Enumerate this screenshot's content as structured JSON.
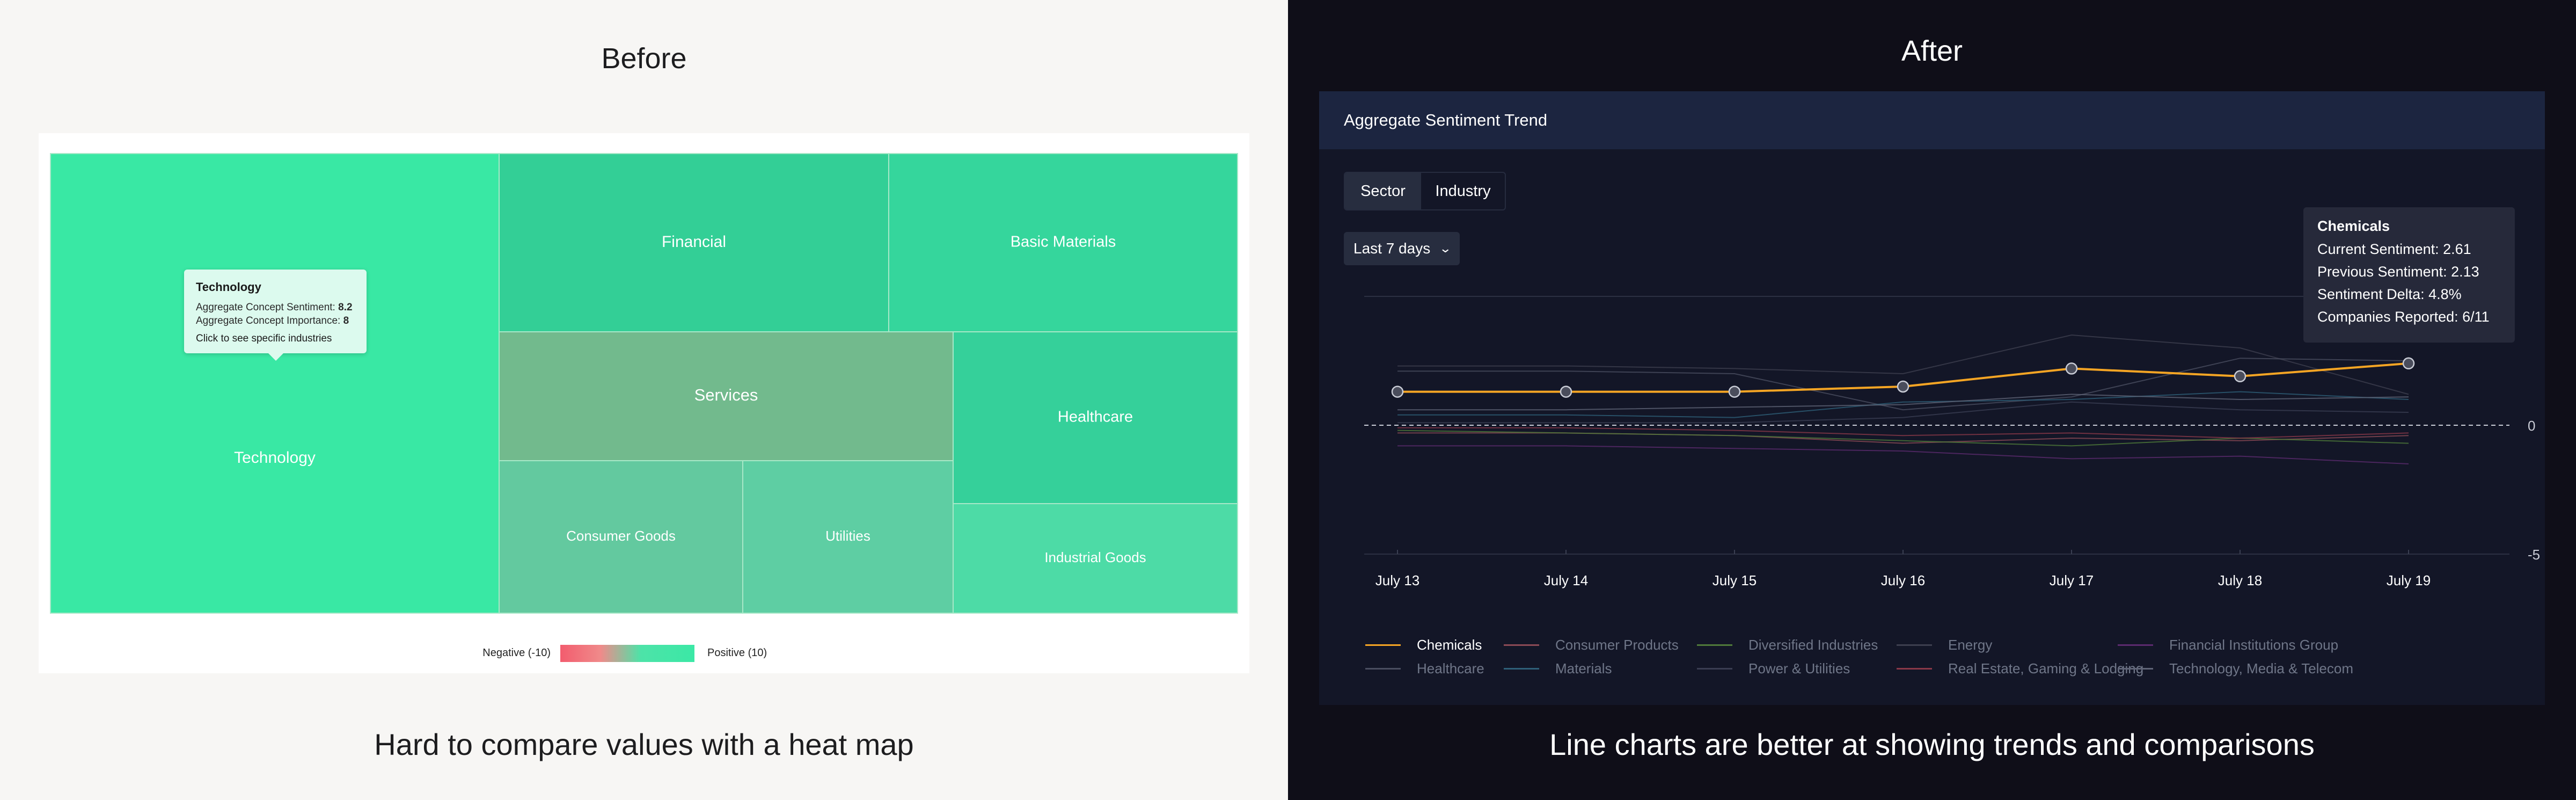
{
  "before": {
    "title": "Before",
    "caption": "Hard to compare values with a heat map",
    "tooltip": {
      "title": "Technology",
      "sentiment_label": "Aggregate Concept Sentiment:",
      "sentiment_value": "8.2",
      "importance_label": "Aggregate Concept Importance:",
      "importance_value": "8",
      "hint": "Click to see specific industries"
    },
    "legend": {
      "negative": "Negative (-10)",
      "positive": "Positive (10)"
    }
  },
  "after": {
    "title": "After",
    "caption": "Line charts are better at showing trends and comparisons",
    "card_title": "Aggregate Sentiment Trend",
    "segments": [
      "Sector",
      "Industry"
    ],
    "selected_segment": "Sector",
    "range_select": "Last 7 days",
    "tooltip": {
      "title": "Chemicals",
      "lines": [
        "Current Sentiment: 2.61",
        "Previous Sentiment: 2.13",
        "Sentiment Delta: 4.8%",
        "Companies Reported: 6/11"
      ]
    }
  },
  "colors": {
    "before_bg": "#f7f6f4",
    "after_bg": "#0f0e18",
    "positive_green": "#3be8a6",
    "negative_red": "#f25c6e",
    "highlight_orange": "#f5a524"
  },
  "chart_data": [
    {
      "type": "heatmap",
      "title": "",
      "tiles": [
        {
          "label": "Technology",
          "color": "#39e8a4"
        },
        {
          "label": "Financial",
          "color": "#33cf96"
        },
        {
          "label": "Basic Materials",
          "color": "#35d69c"
        },
        {
          "label": "Services",
          "color": "#72ba8d"
        },
        {
          "label": "Healthcare",
          "color": "#35d09a"
        },
        {
          "label": "Consumer Goods",
          "color": "#63c99f"
        },
        {
          "label": "Utilities",
          "color": "#5ecea3"
        },
        {
          "label": "Industrial Goods",
          "color": "#4ddba6"
        }
      ],
      "color_scale": {
        "min": -10,
        "max": 10
      }
    },
    {
      "type": "line",
      "title": "Aggregate Sentiment Trend",
      "categories": [
        "July 13",
        "July 14",
        "July 15",
        "July 16",
        "July 17",
        "July 18",
        "July 19"
      ],
      "y_ticks": [
        0,
        -5
      ],
      "ylim": [
        -5,
        5
      ],
      "highlighted_series": "Chemicals",
      "series": [
        {
          "name": "Chemicals",
          "color": "#f5a524",
          "values": [
            1.3,
            1.3,
            1.3,
            1.5,
            2.2,
            1.9,
            2.4
          ]
        },
        {
          "name": "Consumer Products",
          "color": "#8b4a55",
          "values": [
            -0.3,
            -0.3,
            -0.4,
            -0.7,
            -0.5,
            -0.6,
            -0.4
          ]
        },
        {
          "name": "Diversified Industries",
          "color": "#4f7a3a",
          "values": [
            -0.2,
            -0.3,
            -0.4,
            -0.6,
            -0.8,
            -0.5,
            -0.7
          ]
        },
        {
          "name": "Energy",
          "color": "#3d3f4f",
          "values": [
            2.3,
            2.3,
            2.2,
            2.0,
            3.5,
            3.0,
            1.2
          ]
        },
        {
          "name": "Financial Institutions Group",
          "color": "#5b2a6e",
          "values": [
            -0.8,
            -0.8,
            -0.9,
            -1.0,
            -1.3,
            -1.2,
            -1.5
          ]
        },
        {
          "name": "Healthcare",
          "color": "#4a4e60",
          "values": [
            2.1,
            2.1,
            2.0,
            0.6,
            1.1,
            2.6,
            2.5
          ]
        },
        {
          "name": "Materials",
          "color": "#2e5f78",
          "values": [
            0.4,
            0.4,
            0.3,
            0.9,
            1.0,
            1.3,
            1.0
          ]
        },
        {
          "name": "Power & Utilities",
          "color": "#3a3d52",
          "values": [
            0.1,
            0.1,
            0.1,
            0.3,
            0.9,
            0.6,
            0.5
          ]
        },
        {
          "name": "Real Estate, Gaming & Lodging",
          "color": "#8a3848",
          "values": [
            -0.1,
            -0.1,
            -0.2,
            -0.4,
            -0.3,
            -0.5,
            -0.3
          ]
        },
        {
          "name": "Technology, Media & Telecom",
          "color": "#5f6477",
          "values": [
            0.6,
            0.6,
            0.7,
            0.8,
            1.2,
            1.0,
            1.1
          ]
        }
      ]
    }
  ]
}
